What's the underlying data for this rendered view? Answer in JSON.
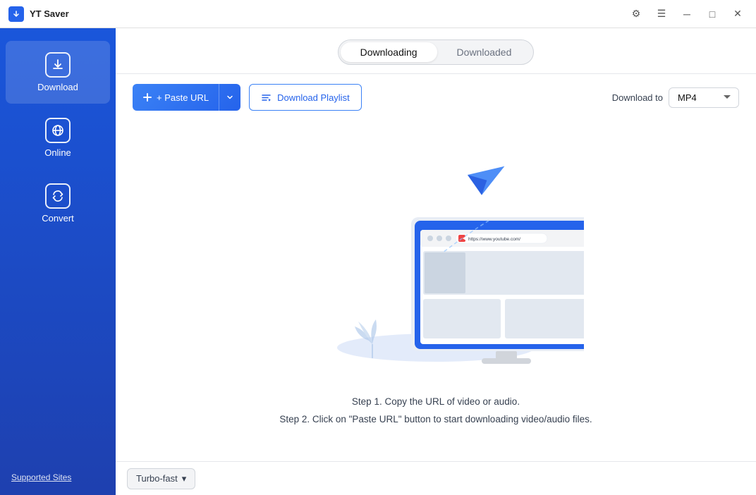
{
  "titleBar": {
    "appName": "YT Saver",
    "appIconText": "▼"
  },
  "tabs": {
    "downloading": "Downloading",
    "downloaded": "Downloaded",
    "activeTab": "downloading"
  },
  "toolbar": {
    "pasteUrlLabel": "+ Paste URL",
    "downloadPlaylistLabel": "Download Playlist",
    "downloadToLabel": "Download to",
    "formatValue": "MP4"
  },
  "illustration": {
    "urlBarText": "https://www.youtube.com/"
  },
  "steps": {
    "step1": "Step 1. Copy the URL of video or audio.",
    "step2": "Step 2. Click on \"Paste URL\" button to start downloading video/audio files."
  },
  "sidebar": {
    "items": [
      {
        "id": "download",
        "label": "Download",
        "icon": "⬇"
      },
      {
        "id": "online",
        "label": "Online",
        "icon": "🌐"
      },
      {
        "id": "convert",
        "label": "Convert",
        "icon": "🔄"
      }
    ]
  },
  "bottomBar": {
    "turboLabel": "Turbo-fast",
    "turboDropdownIcon": "▾"
  },
  "supportedSites": {
    "label": "Supported Sites"
  },
  "controls": {
    "settings": "⚙",
    "menu": "☰",
    "minimize": "─",
    "maximize": "□",
    "close": "✕"
  }
}
